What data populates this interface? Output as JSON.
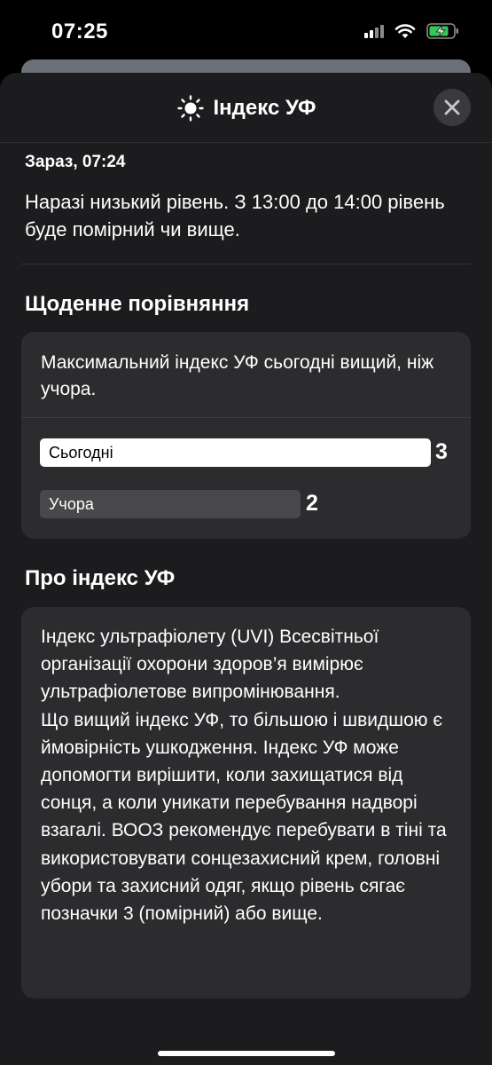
{
  "status_bar": {
    "time": "07:25",
    "icons": [
      "cellular-signal-icon",
      "wifi-icon",
      "battery-charging-icon"
    ],
    "battery_color": "#34c759"
  },
  "header": {
    "icon": "sun-icon",
    "title": "Індекс УФ",
    "close_icon": "close-icon"
  },
  "current": {
    "label": "Зараз, 07:24",
    "text": "Наразі низький рівень. З 13:00 до 14:00 рівень буде помірний чи вище."
  },
  "comparison": {
    "title": "Щоденне порівняння",
    "summary": "Максимальний індекс УФ сьогодні вищий, ніж учора.",
    "scale_max": 3,
    "rows": [
      {
        "label": "Сьогодні",
        "value": 3
      },
      {
        "label": "Учора",
        "value": 2
      }
    ]
  },
  "about": {
    "title": "Про індекс УФ",
    "text": "Індекс ультрафіолету (UVI) Всесвітньої організації охорони здоров’я вимірює ультрафіолетове випромінювання.\nЩо вищий індекс УФ, то більшою і швидшою є ймовірність ушкодження. Індекс УФ може допомогти вирішити, коли захищатися від сонця, а коли уникати перебування надворі взагалі. ВООЗ рекомендує перебувати в тіні та використовувати сонцезахисний крем, головні убори та захисний одяг, якщо рівень сягає позначки 3 (помірний) або вище."
  },
  "colors": {
    "sheet_background": "#1c1c1e",
    "card_background": "#2c2c2e",
    "today_bar": "#ffffff",
    "yesterday_bar": "#48484a"
  }
}
